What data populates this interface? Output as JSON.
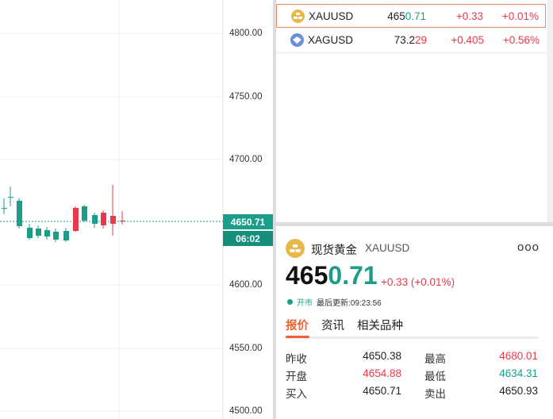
{
  "chart": {
    "y_ticks": [
      "4800.00",
      "4750.00",
      "4700.00",
      "4650.71",
      "4600.00",
      "4550.00",
      "4500.00"
    ],
    "current_price": "4650.71",
    "countdown": "06:02"
  },
  "watchlist": [
    {
      "symbol": "XAUUSD",
      "price_main": "465",
      "price_hl": "0.71",
      "change": "+0.33",
      "percent": "+0.01%",
      "selected": true
    },
    {
      "symbol": "XAGUSD",
      "price_main": "73.2",
      "price_hl": "29",
      "change": "+0.405",
      "percent": "+0.56%",
      "selected": false
    }
  ],
  "detail": {
    "name": "现货黄金",
    "symbol": "XAUUSD",
    "more_label": "ooo",
    "price_main": "465",
    "price_hl": "0.71",
    "change": "+0.33 (+0.01%)",
    "market_status": "开市",
    "last_update": "最后更新:09:23:56",
    "tabs": [
      "报价",
      "资讯",
      "相关品种"
    ],
    "quotes": [
      {
        "label1": "昨收",
        "value1": "4650.38",
        "label2": "最高",
        "value2": "4680.01"
      },
      {
        "label1": "开盘",
        "value1": "4654.88",
        "label2": "最低",
        "value2": "4634.31"
      },
      {
        "label1": "买入",
        "value1": "4650.71",
        "label2": "卖出",
        "value2": "4650.93"
      }
    ]
  },
  "colors": {
    "up": "#e8394a",
    "down": "#1a9e8a",
    "accent": "#f0602a"
  }
}
